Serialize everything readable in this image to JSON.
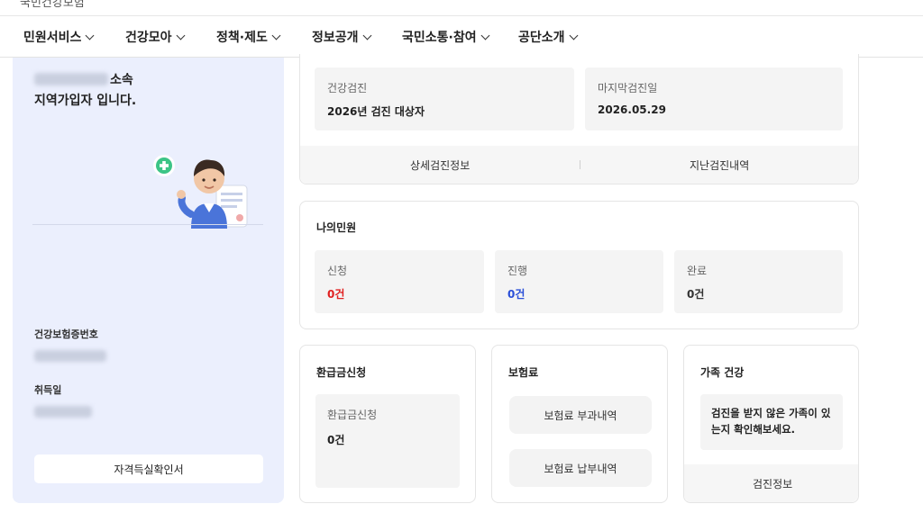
{
  "header": {
    "site_title": "국민건강보험"
  },
  "nav": {
    "items": [
      {
        "label": "민원서비스"
      },
      {
        "label": "건강모아"
      },
      {
        "label": "정책·제도"
      },
      {
        "label": "정보공개"
      },
      {
        "label": "국민소통·참여"
      },
      {
        "label": "공단소개"
      }
    ]
  },
  "profile": {
    "affiliation_suffix": "소속",
    "member_type": "지역가입자 입니다.",
    "insurance_number_label": "건강보험증번호",
    "acquisition_date_label": "취득일",
    "certificate_button": "자격득실확인서"
  },
  "checkup": {
    "left_label": "건강검진",
    "left_value": "2026년 검진 대상자",
    "right_label": "마지막검진일",
    "right_value": "2026.05.29",
    "detail_link": "상세검진정보",
    "history_link": "지난검진내역"
  },
  "civil": {
    "title": "나의민원",
    "applied_label": "신청",
    "applied_value": "0건",
    "progress_label": "진행",
    "progress_value": "0건",
    "done_label": "완료",
    "done_value": "0건"
  },
  "refund": {
    "title": "환급금신청",
    "box_label": "환급금신청",
    "box_value": "0건"
  },
  "premium": {
    "title": "보험료",
    "charge_button": "보험료 부과내역",
    "payment_button": "보험료 납부내역"
  },
  "family": {
    "title": "가족 건강",
    "message": "검진을 받지 않은 가족이 있는지 확인해보세요.",
    "link": "검진정보"
  },
  "colors": {
    "applied": "#e02020",
    "progress": "#2a4fd8",
    "done": "#333333",
    "panel": "#ebeffd"
  }
}
